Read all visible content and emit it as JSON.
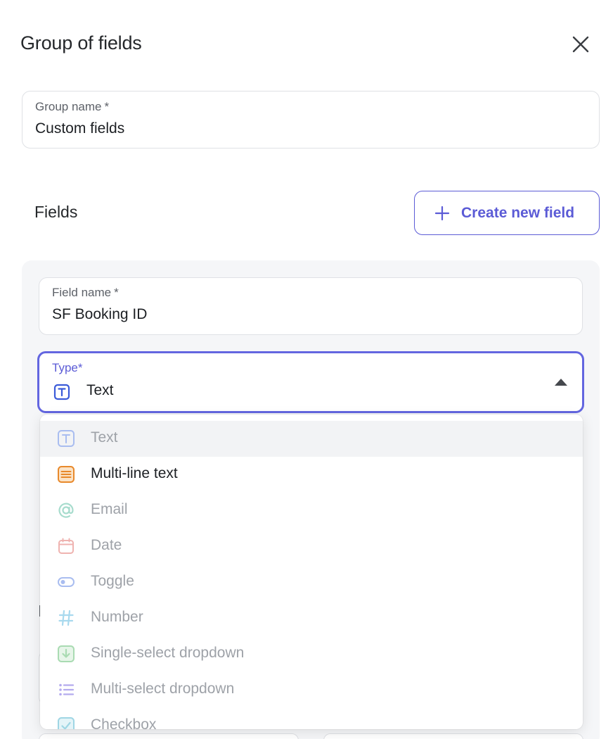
{
  "header": {
    "title": "Group of fields"
  },
  "group_name": {
    "label": "Group name",
    "required_mark": "*",
    "value": "Custom fields"
  },
  "fields_section": {
    "heading": "Fields",
    "create_button": "Create new field"
  },
  "field_name": {
    "label": "Field name",
    "required_mark": "*",
    "value": "SF Booking ID"
  },
  "type_select": {
    "label": "Type*",
    "value": "Text",
    "expanded": true
  },
  "type_options": [
    {
      "label": "Text",
      "icon": "text-type-icon",
      "color": "#8fa7ea",
      "selected": true
    },
    {
      "label": "Multi-line text",
      "icon": "multiline-text-icon",
      "color": "#e8892b",
      "hovered": true
    },
    {
      "label": "Email",
      "icon": "at-sign-icon",
      "color": "#8fd1c0"
    },
    {
      "label": "Date",
      "icon": "calendar-icon",
      "color": "#eda3a3"
    },
    {
      "label": "Toggle",
      "icon": "toggle-icon",
      "color": "#8fa7ea"
    },
    {
      "label": "Number",
      "icon": "hash-icon",
      "color": "#9dd3ea"
    },
    {
      "label": "Single-select dropdown",
      "icon": "single-select-icon",
      "color": "#9ed6a8"
    },
    {
      "label": "Multi-select dropdown",
      "icon": "list-icon",
      "color": "#a79cea"
    },
    {
      "label": "Checkbox",
      "icon": "checkbox-icon",
      "color": "#8fd1e0"
    }
  ],
  "colors": {
    "accent": "#5b5bd6",
    "panel_bg": "#f5f6f8"
  }
}
